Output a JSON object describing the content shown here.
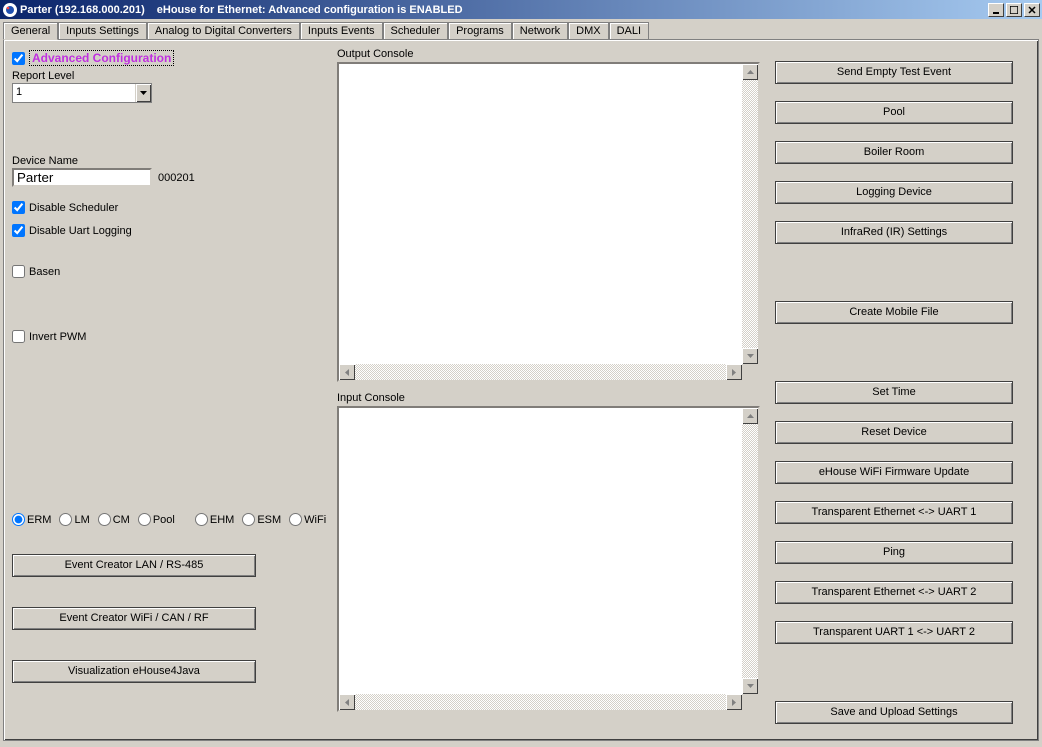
{
  "window": {
    "title1": "Parter (192.168.000.201)",
    "title2": "eHouse for Ethernet: Advanced configuration is ENABLED"
  },
  "tabs": [
    "General",
    "Inputs Settings",
    "Analog to Digital Converters",
    "Inputs Events",
    "Scheduler",
    "Programs",
    "Network",
    "DMX",
    "DALI"
  ],
  "left": {
    "advanced_config": "Advanced Configuration",
    "report_level_label": "Report Level",
    "report_level_value": "1",
    "device_name_label": "Device Name",
    "device_name_value": "Parter",
    "device_code": "000201",
    "disable_scheduler": "Disable Scheduler",
    "disable_uart": "Disable Uart Logging",
    "basen": "Basen",
    "invert_pwm": "Invert PWM",
    "radios": [
      "ERM",
      "LM",
      "CM",
      "Pool",
      "EHM",
      "ESM",
      "WiFi"
    ],
    "btn1": "Event Creator LAN / RS-485",
    "btn2": "Event Creator WiFi / CAN / RF",
    "btn3": "Visualization eHouse4Java"
  },
  "mid": {
    "output_label": "Output Console",
    "input_label": "Input Console"
  },
  "right": {
    "btns": [
      "Send Empty Test Event",
      "Pool",
      "Boiler Room",
      "Logging Device",
      "InfraRed (IR) Settings",
      "Create Mobile File",
      "Set Time",
      "Reset Device",
      "eHouse WiFi Firmware Update",
      "Transparent Ethernet <-> UART 1",
      "Ping",
      "Transparent Ethernet <-> UART 2",
      "Transparent UART 1 <-> UART 2",
      "Save and Upload Settings"
    ]
  }
}
